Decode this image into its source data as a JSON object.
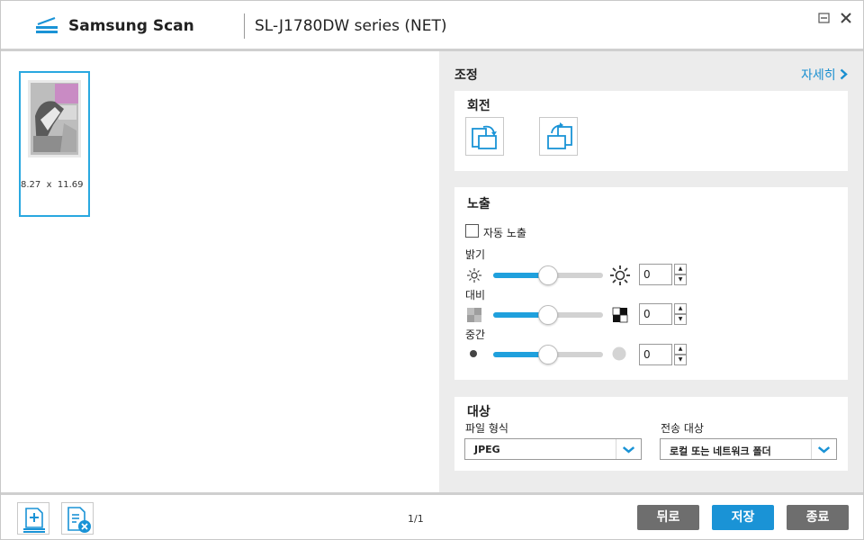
{
  "titlebar": {
    "app_name": "Samsung Scan",
    "device_name": "SL-J1780DW series (NET)",
    "icons": [
      "scanner-logo-icon",
      "minimize-icon",
      "close-icon"
    ]
  },
  "preview": {
    "page_dims": "8.27  x  11.69"
  },
  "adjust": {
    "title": "조정",
    "detail_link": "자세히",
    "rotation": {
      "title": "회전",
      "buttons": [
        "rotate-left",
        "rotate-right"
      ]
    },
    "exposure": {
      "title": "노출",
      "auto_exposure_label": "자동 노출",
      "auto_exposure_checked": false,
      "brightness": {
        "label": "밝기",
        "value": "0",
        "level": 0.5
      },
      "contrast": {
        "label": "대비",
        "value": "0",
        "level": 0.5
      },
      "midtone": {
        "label": "중간",
        "value": "0",
        "level": 0.5
      }
    },
    "destination": {
      "title": "대상",
      "file_format_label": "파일 형식",
      "file_format_value": "JPEG",
      "send_to_label": "전송 대상",
      "send_to_value": "로컬 또는 네트워크 폴더"
    }
  },
  "bottom": {
    "page_count": "1/1",
    "back_label": "뒤로",
    "save_label": "저장",
    "exit_label": "종료"
  },
  "colors": {
    "accent": "#1a93d6",
    "slider_fill": "#1fa0dd",
    "gray_button": "#6e6e6e",
    "panel_bg": "#ececec"
  }
}
